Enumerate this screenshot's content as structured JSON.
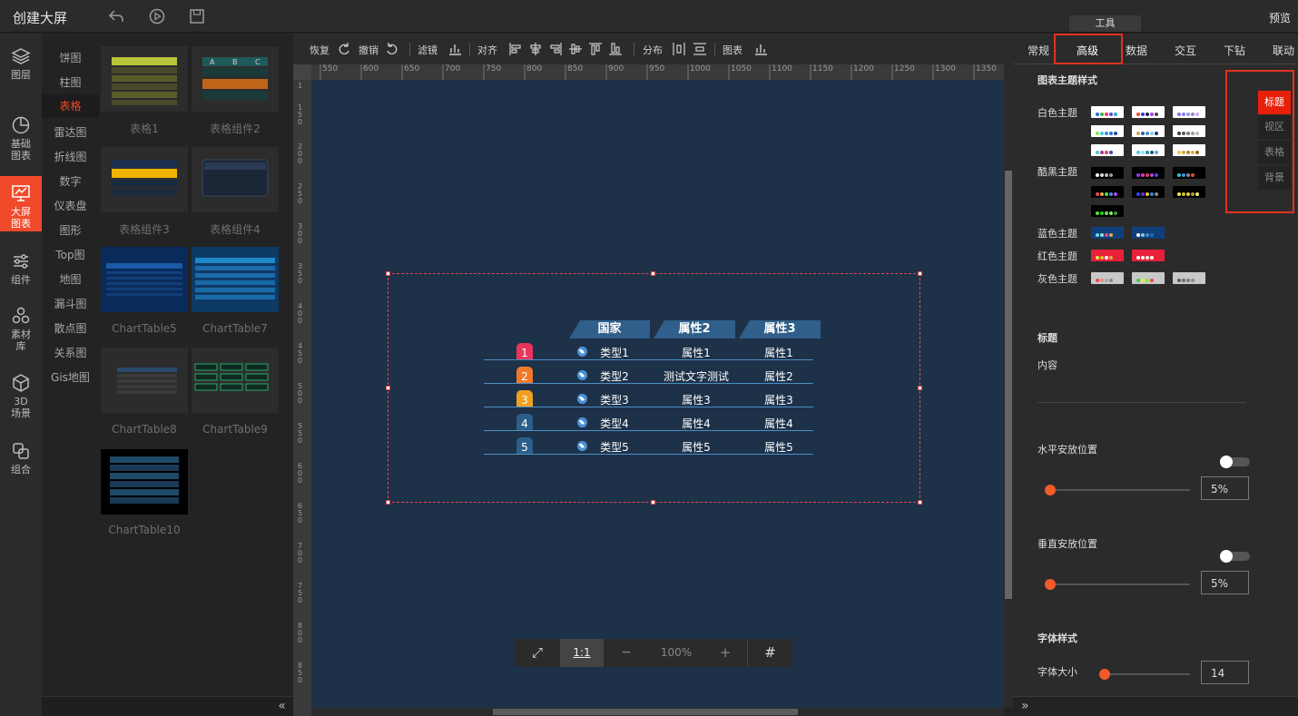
{
  "header": {
    "title": "创建大屏",
    "preview": "预览",
    "tools_tab": "工具"
  },
  "leftnav": [
    {
      "icon": "layers-icon",
      "label": "图层"
    },
    {
      "icon": "pie-chart-icon",
      "label": "基础\n图表"
    },
    {
      "icon": "screen-chart-icon",
      "label": "大屏\n图表"
    },
    {
      "icon": "sliders-icon",
      "label": "组件"
    },
    {
      "icon": "assets-icon",
      "label": "素材\n库"
    },
    {
      "icon": "cube-icon",
      "label": "3D\n场景"
    },
    {
      "icon": "group-icon",
      "label": "组合"
    }
  ],
  "categories": [
    "饼图",
    "柱图",
    "表格",
    "雷达图",
    "折线图",
    "数字",
    "仪表盘",
    "图形",
    "Top图",
    "地图",
    "漏斗图",
    "散点图",
    "关系图",
    "Gis地图"
  ],
  "active_category": "表格",
  "thumbnails": [
    "表格1",
    "表格组件2",
    "表格组件3",
    "表格组件4",
    "ChartTable5",
    "ChartTable7",
    "ChartTable8",
    "ChartTable9",
    "ChartTable10"
  ],
  "toolbar": {
    "redo": "恢复",
    "undo": "撤销",
    "filter": "滤镜",
    "align": "对齐",
    "distribute": "分布",
    "chart": "图表"
  },
  "ruler_h": [
    "550",
    "600",
    "650",
    "700",
    "750",
    "800",
    "850",
    "900",
    "950",
    "1000",
    "1050",
    "1100",
    "1150",
    "1200",
    "1250",
    "1300",
    "1350"
  ],
  "ruler_v": [
    "1",
    "1\n5\n0",
    "2\n0\n0",
    "2\n5\n0",
    "3\n0\n0",
    "3\n5\n0",
    "4\n0\n0",
    "4\n5\n0",
    "5\n0\n0",
    "5\n5\n0",
    "6\n0\n0",
    "6\n5\n0",
    "7\n0\n0",
    "7\n5\n0",
    "8\n0\n0",
    "8\n5\n0"
  ],
  "table": {
    "headers": [
      "国家",
      "属性2",
      "属性3"
    ],
    "rows": [
      {
        "rank": "1",
        "name": "类型1",
        "a": "属性1",
        "b": "属性1",
        "color": "#e8355a"
      },
      {
        "rank": "2",
        "name": "类型2",
        "a": "测试文字测试",
        "b": "属性2",
        "color": "#f07a2a"
      },
      {
        "rank": "3",
        "name": "类型3",
        "a": "属性3",
        "b": "属性3",
        "color": "#f0a020"
      },
      {
        "rank": "4",
        "name": "类型4",
        "a": "属性4",
        "b": "属性4",
        "color": "#2d5f8a"
      },
      {
        "rank": "5",
        "name": "类型5",
        "a": "属性5",
        "b": "属性5",
        "color": "#2d5f8a"
      }
    ]
  },
  "zoom": {
    "fit": "⤢",
    "one": "1:1",
    "minus": "−",
    "value": "100%",
    "plus": "+",
    "grid": "#"
  },
  "rightpanel": {
    "tabs": [
      "常规",
      "高级",
      "数据",
      "交互",
      "下钻",
      "联动"
    ],
    "active_tab": "高级",
    "theme_title": "图表主题样式",
    "themes": {
      "white": "白色主题",
      "dark": "酷黑主题",
      "blue": "蓝色主题",
      "red": "红色主题",
      "gray": "灰色主题"
    },
    "side_options": [
      "标题",
      "视区",
      "表格",
      "背景"
    ],
    "active_side": "标题",
    "title_section": "标题",
    "content_label": "内容",
    "h_pos_label": "水平安放位置",
    "h_pos_value": "5%",
    "v_pos_label": "垂直安放位置",
    "v_pos_value": "5%",
    "font_section": "字体样式",
    "font_size_label": "字体大小",
    "font_size_value": "14"
  },
  "colors": {
    "accent": "#f04a2a",
    "canvas": "#1d3149",
    "header_cell": "#2f5f8a"
  }
}
